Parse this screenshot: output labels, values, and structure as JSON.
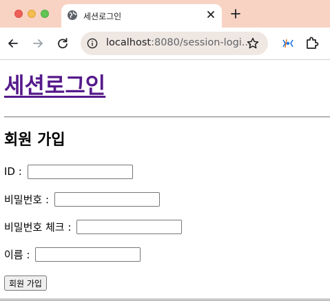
{
  "browser": {
    "tab_title": "세션로그인",
    "url_host": "localhost",
    "url_rest": ":8080/session-logi...",
    "theme_color": "#f8d3c3"
  },
  "page": {
    "site_title": "세션로그인",
    "section_title": "회원 가입",
    "fields": [
      {
        "label": "ID : ",
        "value": ""
      },
      {
        "label": "비밀번호 : ",
        "value": ""
      },
      {
        "label": "비밀번호 체크 : ",
        "value": ""
      },
      {
        "label": "이름 : ",
        "value": ""
      }
    ],
    "submit_label": "회원 가입",
    "link_color": "#551a8b"
  }
}
